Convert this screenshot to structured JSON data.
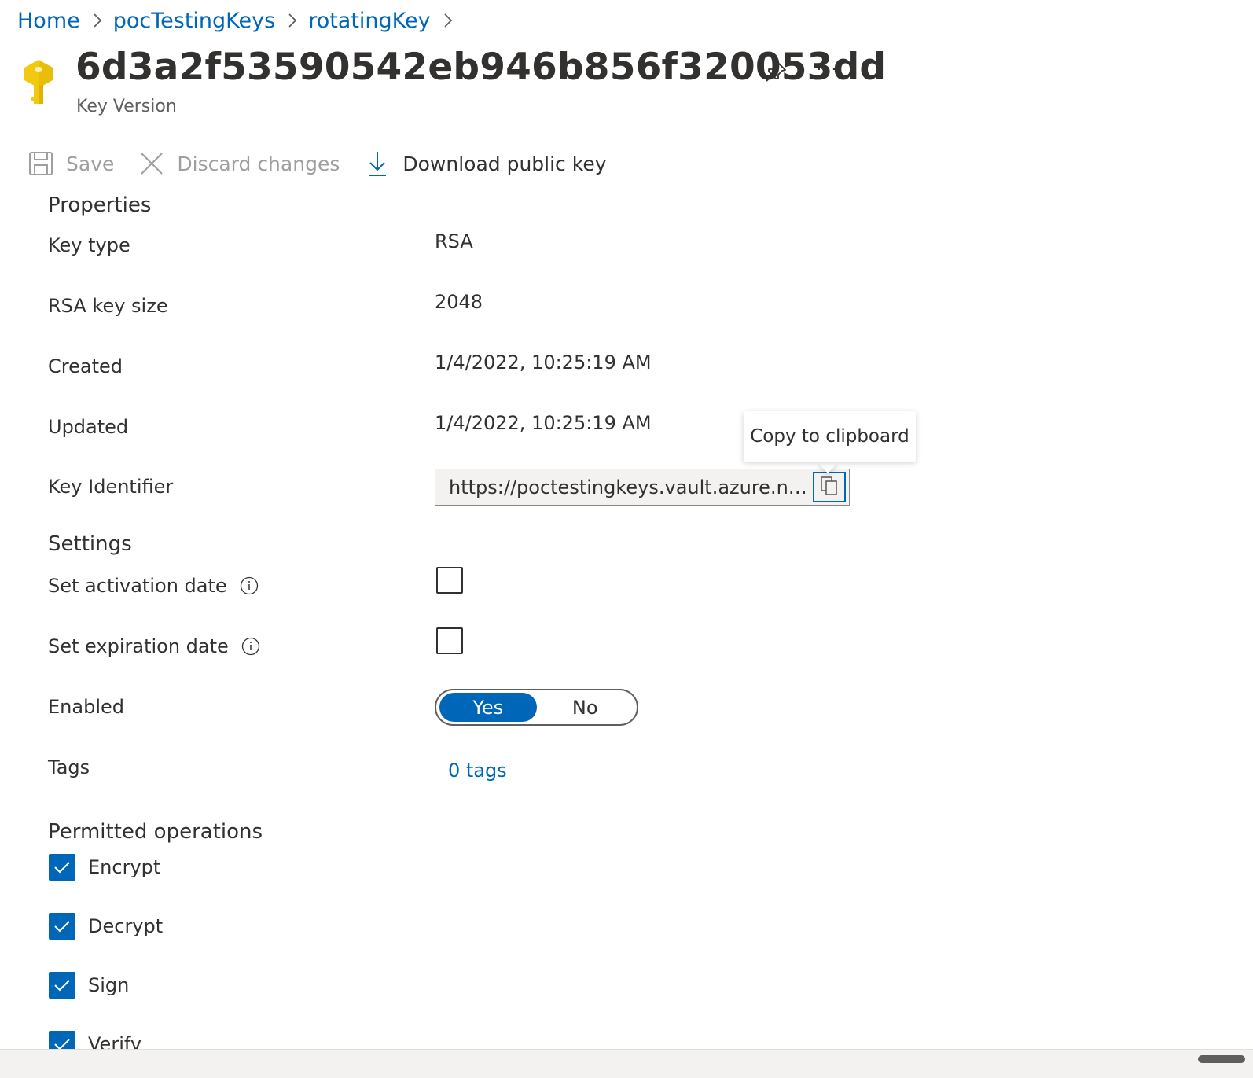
{
  "breadcrumb": [
    {
      "label": "Home"
    },
    {
      "label": "pocTestingKeys"
    },
    {
      "label": "rotatingKey"
    }
  ],
  "header": {
    "title": "6d3a2f53590542eb946b856f320053dd",
    "subtitle": "Key Version",
    "more_label": "···"
  },
  "toolbar": {
    "save_label": "Save",
    "discard_label": "Discard changes",
    "download_label": "Download public key"
  },
  "properties": {
    "heading": "Properties",
    "key_type_label": "Key type",
    "key_type_value": "RSA",
    "key_size_label": "RSA key size",
    "key_size_value": "2048",
    "created_label": "Created",
    "created_value": "1/4/2022, 10:25:19 AM",
    "updated_label": "Updated",
    "updated_value": "1/4/2022, 10:25:19 AM",
    "identifier_label": "Key Identifier",
    "identifier_value": "https://poctestingkeys.vault.azure.net/...",
    "tooltip": "Copy to clipboard"
  },
  "settings": {
    "heading": "Settings",
    "activation_label": "Set activation date",
    "activation_checked": false,
    "expiration_label": "Set expiration date",
    "expiration_checked": false,
    "enabled_label": "Enabled",
    "enabled_yes": "Yes",
    "enabled_no": "No",
    "enabled_value": "Yes",
    "tags_label": "Tags",
    "tags_value": "0 tags"
  },
  "permitted_operations": {
    "heading": "Permitted operations",
    "items": [
      {
        "label": "Encrypt",
        "checked": true
      },
      {
        "label": "Decrypt",
        "checked": true
      },
      {
        "label": "Sign",
        "checked": true
      },
      {
        "label": "Verify",
        "checked": true
      }
    ]
  },
  "colors": {
    "accent": "#0067b8",
    "key_icon": "#f2c811",
    "text": "#323130",
    "muted": "#a19f9d"
  }
}
